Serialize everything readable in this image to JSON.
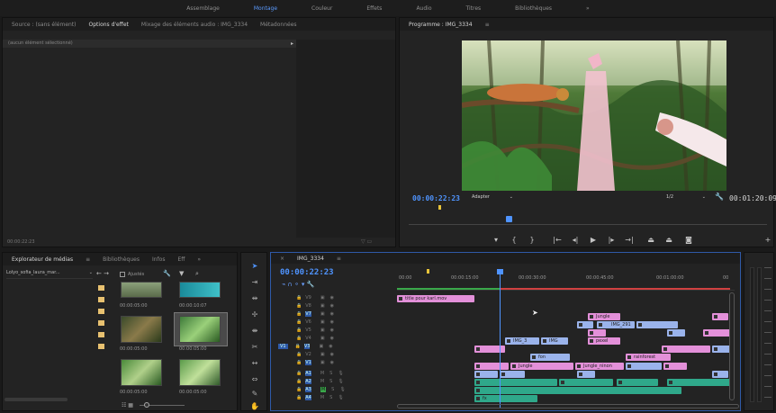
{
  "workspace": {
    "tabs": [
      "Assemblage",
      "Montage",
      "Couleur",
      "Effets",
      "Audio",
      "Titres",
      "Bibliothèques"
    ],
    "active_index": 1,
    "more": "»"
  },
  "source_panel": {
    "tabs": [
      "Source : (sans élément)",
      "Options d'effet",
      "Mixage des éléments audio : IMG_3334",
      "Métadonnées"
    ],
    "active_index": 1,
    "empty_label": "(aucun élément sélectionné)",
    "timecode": "00:00:22:23"
  },
  "program": {
    "title": "Programme : IMG_3334",
    "timecode": "00:00:22:23",
    "fit": "Adapter",
    "ratio": "1/2",
    "duration": "00:01:20:09",
    "playhead_fraction": 0.28
  },
  "media": {
    "tabs": [
      "Explorateur de médias",
      "Bibliothèques",
      "Infos",
      "Eff"
    ],
    "path": "Lolyo_sofia_laura_mar...",
    "filter_label": "Ajustés",
    "thumbs": [
      {
        "name": "",
        "duration": "00:00:05:00"
      },
      {
        "name": "",
        "duration": "00:00:10:07"
      },
      {
        "name": "",
        "duration": "00:00:05:00"
      },
      {
        "name": "",
        "duration": "00:00:05:00"
      },
      {
        "name": "",
        "duration": "00:00:05:00"
      },
      {
        "name": "",
        "duration": "00:00:05:00"
      }
    ]
  },
  "timeline": {
    "tab": "IMG_3334",
    "timecode": "00:00:22:23",
    "ruler": [
      "00:00",
      "00:00:15:00",
      "00:00:30:00",
      "00:00:45:00",
      "00:01:00:00",
      "00"
    ],
    "video_tracks": [
      "V9",
      "V8",
      "V7",
      "V6",
      "V5",
      "V4",
      "V3",
      "V2",
      "V1"
    ],
    "audio_tracks": [
      "A1",
      "A2",
      "A3",
      "A4"
    ],
    "source_patch_v": "V1",
    "source_patch_a": "A1",
    "clips": {
      "c1": "title pour karl.mov",
      "c2": "Jungle",
      "c3": "IMG_3",
      "c4": "IMG_291",
      "c5": "IMG_3",
      "c6": "IMG",
      "c7": "pexel",
      "c8": "fon",
      "c9": "rainforest",
      "c10": "Jungle",
      "c11": "Jungle_ninon",
      "c12": "fx"
    }
  }
}
